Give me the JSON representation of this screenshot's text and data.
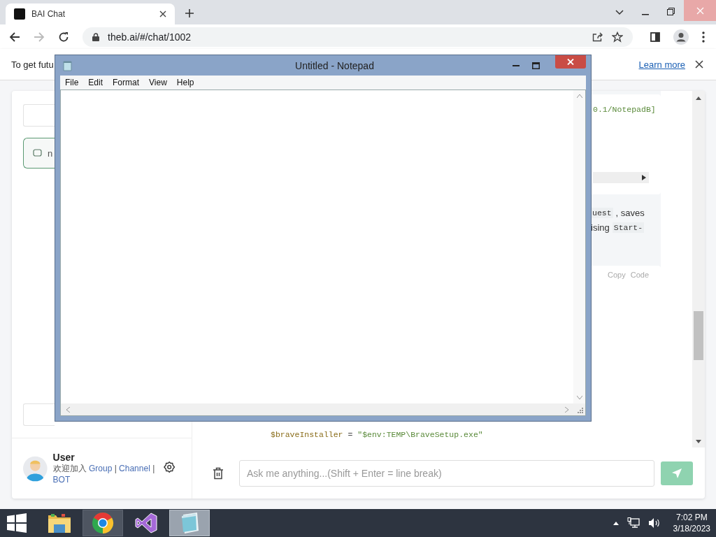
{
  "browser": {
    "tab": {
      "title": "BAI Chat"
    },
    "forward_disabled": true,
    "address": "theb.ai/#/chat/1002"
  },
  "infobar": {
    "text": "To get futu",
    "link": "Learn more"
  },
  "sidebar": {
    "conversations": [
      {
        "title": "n",
        "selected": true
      }
    ],
    "user": {
      "name": "User",
      "welcome": "欢迎加入",
      "links": [
        "Group",
        "Channel",
        "BOT"
      ],
      "separator": "|"
    }
  },
  "chat": {
    "code_block_1": {
      "tokens": [
        {
          "text": "0.1/NotepadB]",
          "kind": "string"
        }
      ]
    },
    "paragraph_lines": [
      [
        {
          "text": "uest",
          "kind": "code"
        },
        {
          "text": ", saves",
          "kind": "plain"
        }
      ],
      [
        {
          "text": "ising",
          "kind": "plain"
        },
        {
          "text": "Start-",
          "kind": "code"
        }
      ]
    ],
    "code_block_2": {
      "actions": [
        "Copy",
        "Code"
      ],
      "lines": [
        [
          {
            "text": "$braveInstaller",
            "kind": "variable"
          },
          {
            "text": " = ",
            "kind": "plain"
          },
          {
            "text": "\"$env:TEMP\\BraveSetup.exe\"",
            "kind": "string"
          }
        ]
      ]
    }
  },
  "composer": {
    "placeholder": "Ask me anything...(Shift + Enter = line break)"
  },
  "notepad": {
    "title": "Untitled - Notepad",
    "menu": [
      "File",
      "Edit",
      "Format",
      "View",
      "Help"
    ]
  },
  "taskbar": {
    "apps": [
      {
        "kind": "explorer",
        "open": false,
        "selected": false
      },
      {
        "kind": "chrome",
        "open": true,
        "selected": false
      },
      {
        "kind": "visual-studio",
        "open": false,
        "selected": false
      },
      {
        "kind": "notepad",
        "open": true,
        "selected": true
      }
    ],
    "time": "7:02 PM",
    "date": "3/18/2023"
  }
}
